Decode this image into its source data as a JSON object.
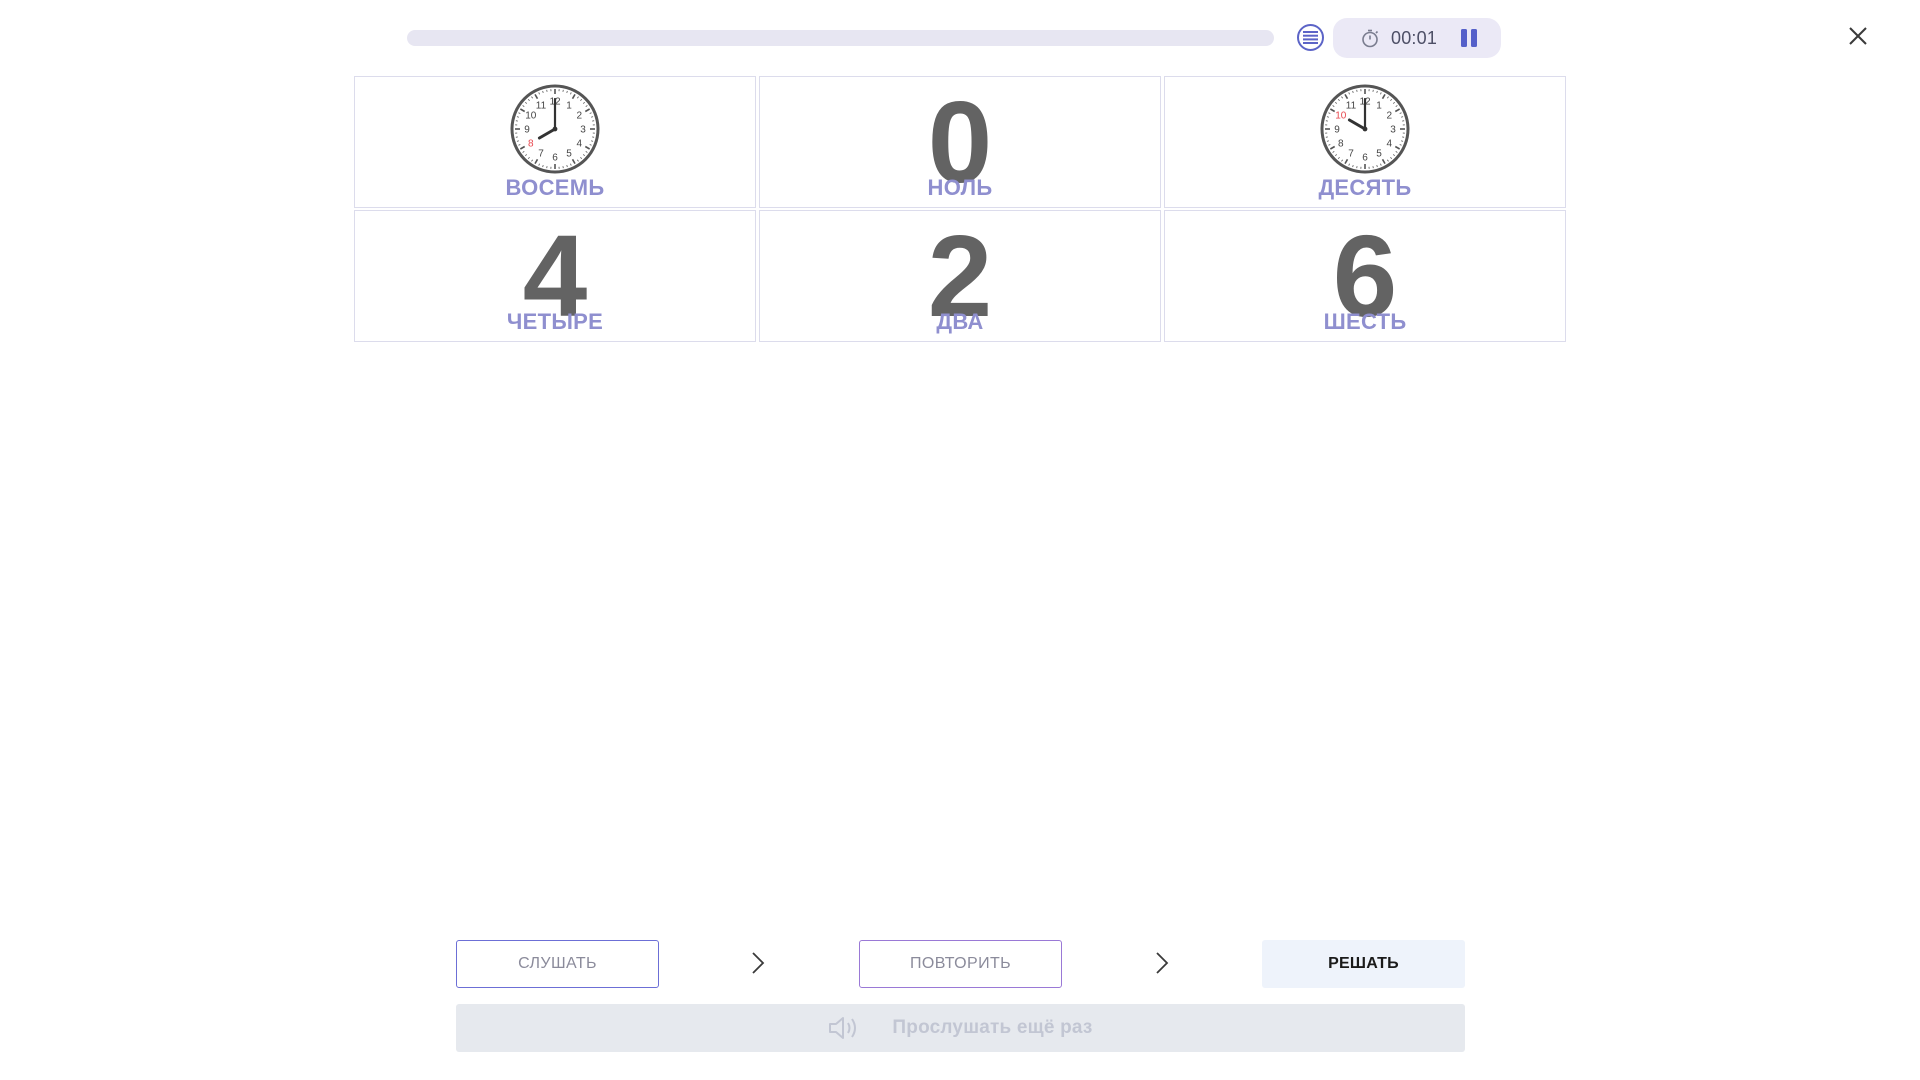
{
  "header": {
    "timer": "00:01",
    "progress": 0
  },
  "cards": [
    {
      "type": "clock",
      "hour": 8,
      "word": "ВОСЕМЬ"
    },
    {
      "type": "digit",
      "digit": "0",
      "word": "НОЛЬ"
    },
    {
      "type": "clock",
      "hour": 10,
      "word": "ДЕСЯТЬ"
    },
    {
      "type": "digit",
      "digit": "4",
      "word": "ЧЕТЫРЕ"
    },
    {
      "type": "digit",
      "digit": "2",
      "word": "ДВА"
    },
    {
      "type": "digit",
      "digit": "6",
      "word": "ШЕСТЬ"
    }
  ],
  "steps": {
    "listen": "СЛУШАТЬ",
    "repeat": "ПОВТОРИТЬ",
    "solve": "РЕШАТЬ"
  },
  "replay": {
    "label": "Прослушать ещё раз"
  },
  "colors": {
    "accent": "#5560c9",
    "word": "#8f8fcf",
    "digit": "#636363",
    "highlight_hour": "#e8474e"
  },
  "icons": {
    "list": "list-icon",
    "stopwatch": "stopwatch-icon",
    "pause": "pause-icon",
    "close": "close-icon",
    "chevron": "chevron-right-icon",
    "speaker": "speaker-icon"
  }
}
